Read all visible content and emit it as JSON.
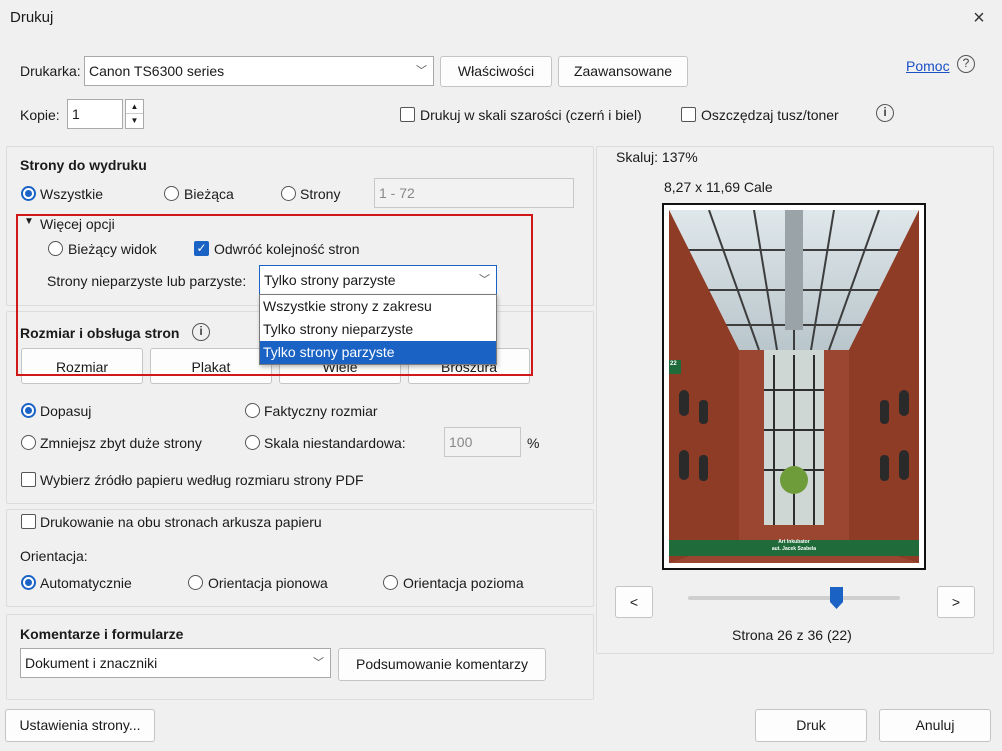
{
  "dialog": {
    "title": "Drukuj",
    "close_icon": "×"
  },
  "printer": {
    "label": "Drukarka:",
    "selected": "Canon TS6300 series",
    "properties_button": "Właściwości",
    "advanced_button": "Zaawansowane",
    "help_link": "Pomoc",
    "copies_label": "Kopie:",
    "copies_value": "1",
    "grayscale_label": "Drukuj w skali szarości (czerń i biel)",
    "save_ink_label": "Oszczędzaj tusz/toner"
  },
  "pages": {
    "heading": "Strony do wydruku",
    "all": "Wszystkie",
    "current": "Bieżąca",
    "pages": "Strony",
    "range_placeholder": "1 - 72",
    "more_options": "Więcej opcji",
    "current_view": "Bieżący widok",
    "reverse_order": "Odwróć kolejność stron",
    "odd_even_label": "Strony nieparzyste lub parzyste:",
    "odd_even_selected": "Tylko strony parzyste",
    "odd_even_options": [
      "Wszystkie strony z zakresu",
      "Tylko strony nieparzyste",
      "Tylko strony parzyste"
    ]
  },
  "sizing": {
    "heading": "Rozmiar i obsługa stron",
    "tabs": [
      "Rozmiar",
      "Plakat",
      "Wiele",
      "Broszura"
    ],
    "fit": "Dopasuj",
    "actual_size": "Faktyczny rozmiar",
    "shrink": "Zmniejsz zbyt duże strony",
    "custom_scale": "Skala niestandardowa:",
    "custom_scale_value": "100",
    "percent": "%",
    "paper_source": "Wybierz źródło papieru według rozmiaru strony PDF"
  },
  "duplex": {
    "label": "Drukowanie na obu stronach arkusza papieru",
    "orientation_label": "Orientacja:",
    "auto": "Automatycznie",
    "portrait": "Orientacja pionowa",
    "landscape": "Orientacja pozioma"
  },
  "comments": {
    "heading": "Komentarze i formularze",
    "selected": "Dokument i znaczniki",
    "summarize_button": "Podsumowanie komentarzy"
  },
  "preview": {
    "scale": "Skaluj: 137%",
    "paper_size": "8,27 x 11,69 Cale",
    "page_badge": "22",
    "page_caption_1": "Art Inkubator",
    "page_caption_2": "aut. Jacek Szabela",
    "prev": "<",
    "next": ">",
    "page_status": "Strona 26 z 36 (22)",
    "slider_position": 0.45
  },
  "footer": {
    "page_setup_button": "Ustawienia strony...",
    "print_button": "Druk",
    "cancel_button": "Anuluj"
  },
  "colors": {
    "accent": "#1a63c5",
    "highlight": "#d01818"
  }
}
